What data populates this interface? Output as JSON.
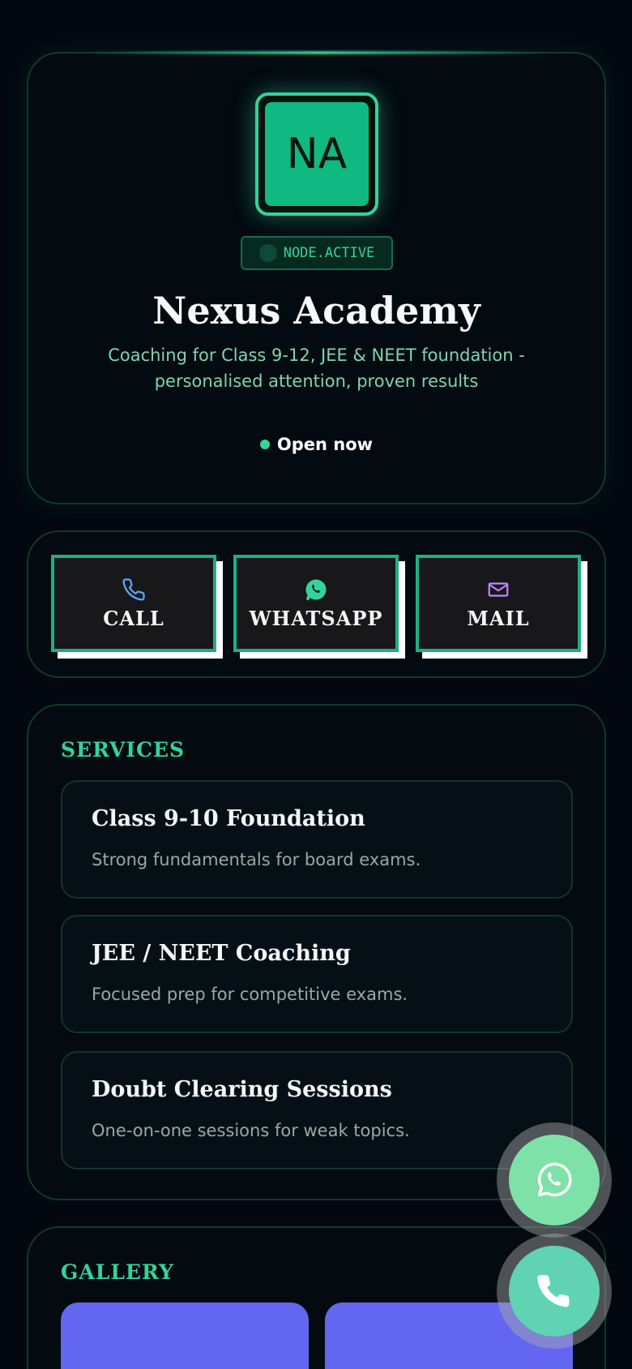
{
  "hero": {
    "logo_initials": "NA",
    "node_badge": "NODE.ACTIVE",
    "title": "Nexus Academy",
    "subtitle": "Coaching for Class 9-12, JEE & NEET foundation - personalised attention, proven results",
    "status": "Open now"
  },
  "actions": {
    "call_label": "CALL",
    "whatsapp_label": "WHATSAPP",
    "mail_label": "MAIL"
  },
  "services": {
    "heading": "SERVICES",
    "items": [
      {
        "title": "Class 9-10 Foundation",
        "desc": "Strong fundamentals for board exams."
      },
      {
        "title": "JEE / NEET Coaching",
        "desc": "Focused prep for competitive exams."
      },
      {
        "title": "Doubt Clearing Sessions",
        "desc": "One-on-one sessions for weak topics."
      }
    ]
  },
  "gallery": {
    "heading": "GALLERY",
    "image_color": "#6366f1"
  },
  "icons": {
    "call": "phone-icon",
    "whatsapp": "whatsapp-icon",
    "mail": "mail-icon",
    "fab_whatsapp": "whatsapp-icon",
    "fab_call": "phone-icon"
  },
  "colors": {
    "accent": "#34d399",
    "accent_dark": "#10b981",
    "background": "#030810",
    "call_icon": "#60a5fa",
    "whatsapp_icon": "#34d399",
    "mail_icon": "#c084fc",
    "fab_whatsapp": "#7ee2a8",
    "fab_call": "#5fd3b4"
  }
}
